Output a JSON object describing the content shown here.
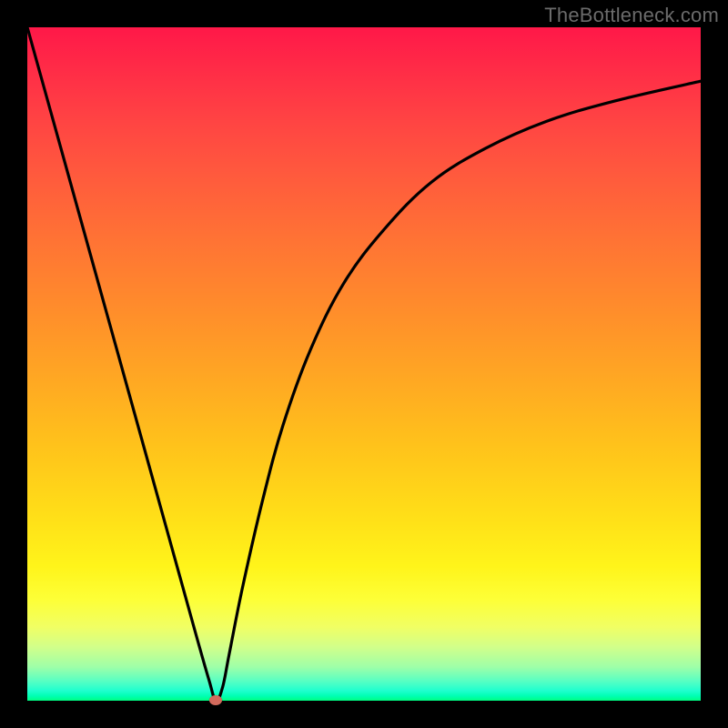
{
  "watermark": "TheBottleneck.com",
  "colors": {
    "background": "#000000",
    "curve": "#000000",
    "marker": "#d26a5c",
    "gradient_top": "#ff1848",
    "gradient_bottom": "#00ff81"
  },
  "chart_data": {
    "type": "line",
    "title": "",
    "xlabel": "",
    "ylabel": "",
    "xlim": [
      0,
      100
    ],
    "ylim": [
      0,
      100
    ],
    "series": [
      {
        "name": "bottleneck-curve",
        "x": [
          0,
          5,
          10,
          15,
          20,
          25,
          27,
          28,
          29,
          30,
          32,
          35,
          38,
          42,
          47,
          53,
          60,
          68,
          77,
          87,
          100
        ],
        "values": [
          100,
          82,
          64,
          46,
          28,
          10,
          3,
          0,
          2,
          7,
          17,
          30,
          41,
          52,
          62,
          70,
          77,
          82,
          86,
          89,
          92
        ]
      }
    ],
    "annotations": [
      {
        "name": "min-marker",
        "x": 28,
        "y": 0
      }
    ],
    "grid": false,
    "legend": false
  }
}
